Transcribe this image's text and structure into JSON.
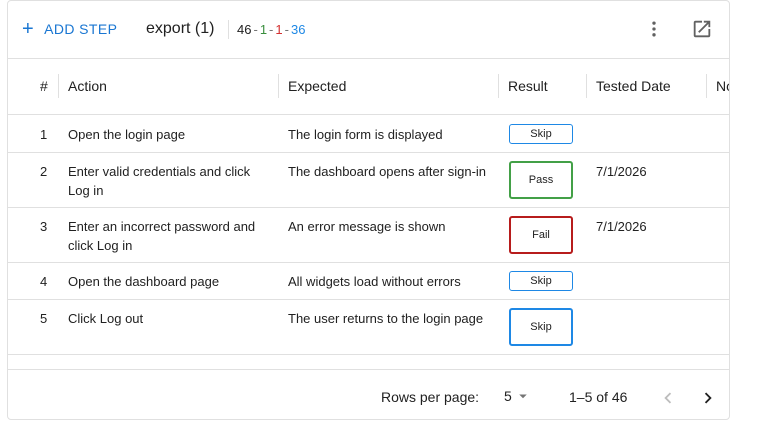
{
  "toolbar": {
    "add_step_label": "ADD STEP",
    "add_icon": "plus-icon",
    "title": "export (1)",
    "counts": {
      "total": "46",
      "pass": "1",
      "fail": "1",
      "skip": "36",
      "separator": "-"
    },
    "more_icon": "more-vert-icon",
    "open_icon": "open-in-new-icon"
  },
  "table": {
    "headers": {
      "num": "#",
      "action": "Action",
      "expected": "Expected",
      "result": "Result",
      "tested_date": "Tested Date",
      "notes": "No"
    },
    "rows": [
      {
        "num": "1",
        "action": "Open the login page",
        "expected": "The login form is displayed",
        "result": "Skip",
        "date": ""
      },
      {
        "num": "2",
        "action": "Enter valid credentials and click Log in",
        "expected": "The dashboard opens after sign-in",
        "result": "Pass",
        "date": "7/1/2026"
      },
      {
        "num": "3",
        "action": "Enter an incorrect password and click Log in",
        "expected": "An error message is shown",
        "result": "Fail",
        "date": "7/1/2026"
      },
      {
        "num": "4",
        "action": "Open the dashboard page",
        "expected": "All widgets load without errors",
        "result": "Skip",
        "date": ""
      },
      {
        "num": "5",
        "action": "Click Log out",
        "expected": "The user returns to the login page",
        "result": "Skip",
        "date": ""
      }
    ]
  },
  "footer": {
    "rows_per_page_label": "Rows per page:",
    "rows_per_page_value": "5",
    "range": "1–5 of 46",
    "prev_icon": "chevron-left-icon",
    "next_icon": "chevron-right-icon"
  },
  "colors": {
    "accent": "#1976d2",
    "pass": "#388e3c",
    "fail": "#b71c1c",
    "skip": "#1e88e5"
  }
}
